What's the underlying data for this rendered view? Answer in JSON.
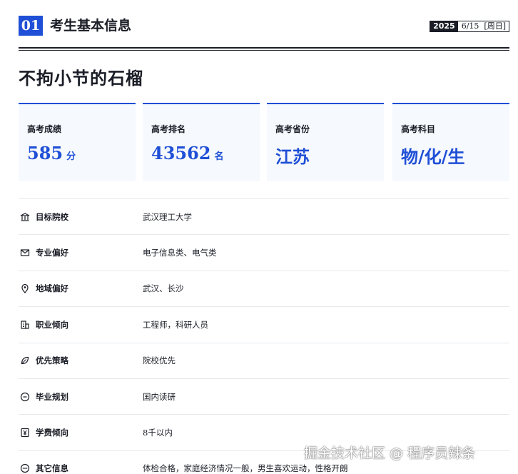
{
  "section": {
    "number": "01",
    "title": "考生基本信息"
  },
  "date": {
    "year": "2025",
    "month_day": "6/15",
    "weekday": "[周日]"
  },
  "candidate_name": "不拘小节的石榴",
  "cards": [
    {
      "label": "高考成绩",
      "value": "585",
      "unit": "分"
    },
    {
      "label": "高考排名",
      "value": "43562",
      "unit": "名"
    },
    {
      "label": "高考省份",
      "value": "江苏",
      "unit": ""
    },
    {
      "label": "高考科目",
      "value": "物/化/生",
      "unit": ""
    }
  ],
  "rows": [
    {
      "icon": "school-icon",
      "label": "目标院校",
      "value": "武汉理工大学"
    },
    {
      "icon": "mail-icon",
      "label": "专业偏好",
      "value": "电子信息类、电气类"
    },
    {
      "icon": "location-pin-icon",
      "label": "地域偏好",
      "value": "武汉、长沙"
    },
    {
      "icon": "building-icon",
      "label": "职业倾向",
      "value": "工程师，科研人员"
    },
    {
      "icon": "leaf-icon",
      "label": "优先策略",
      "value": "院校优先"
    },
    {
      "icon": "minus-circle-icon",
      "label": "毕业规划",
      "value": "国内读研"
    },
    {
      "icon": "yuan-icon",
      "label": "学费倾向",
      "value": "8千以内"
    },
    {
      "icon": "more-icon",
      "label": "其它信息",
      "value": "体检合格，家庭经济情况一般，男生喜欢运动，性格开朗"
    }
  ],
  "watermark": "掘金技术社区 @ 程序员辣条"
}
